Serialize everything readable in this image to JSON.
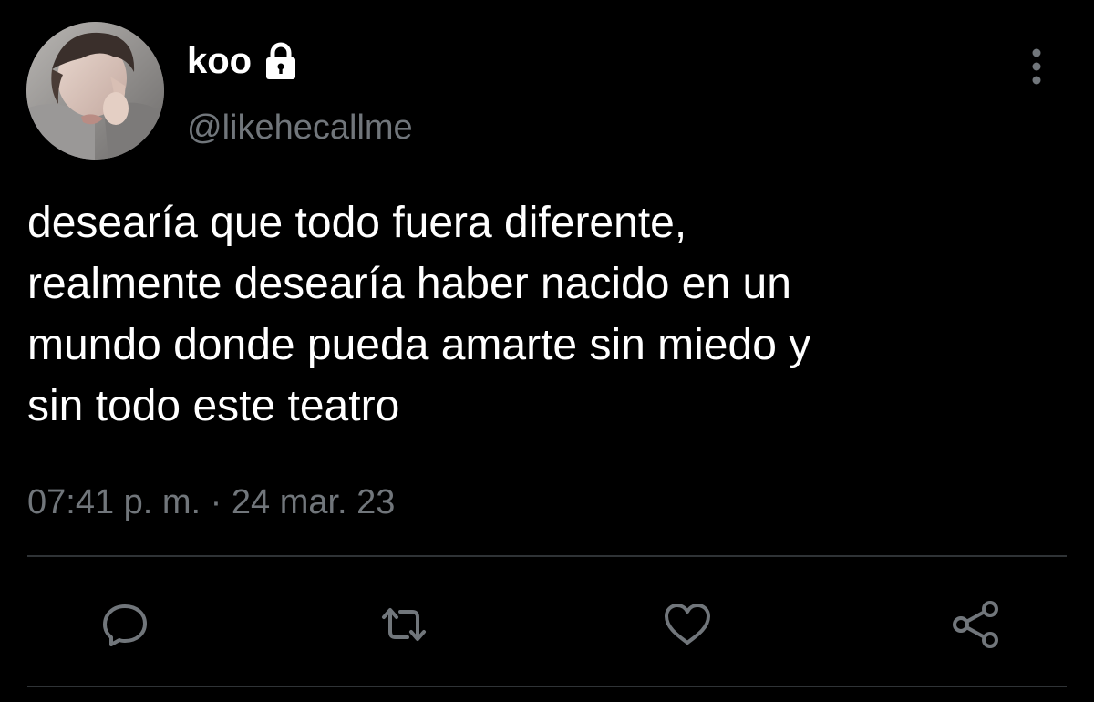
{
  "tweet": {
    "display_name": "koo",
    "handle": "@likehecallme",
    "text": "desearía que todo fuera diferente,\nrealmente desearía haber nacido en un\nmundo donde pueda amarte sin miedo y\nsin todo este teatro",
    "timestamp": "07:41 p. m. · 24 mar. 23"
  },
  "icons": {
    "lock": "lock-icon",
    "more": "more-vertical-icon",
    "reply": "reply-icon",
    "retweet": "retweet-icon",
    "like": "heart-icon",
    "share": "share-icon"
  },
  "colors": {
    "background": "#000000",
    "text_primary": "#ffffff",
    "text_secondary": "#71767b",
    "divider": "#2f3336",
    "icon": "#71767b"
  }
}
